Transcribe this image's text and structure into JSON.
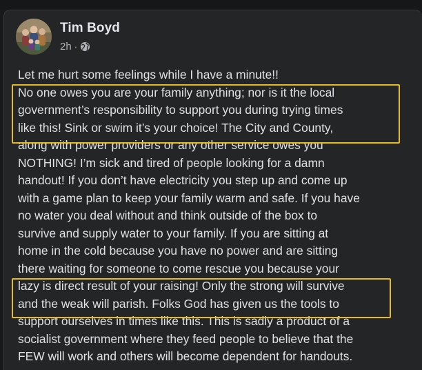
{
  "post": {
    "author": "Tim Boyd",
    "timestamp": "2h",
    "separator": "·",
    "privacy_icon": "globe-icon",
    "lines": [
      "Let me hurt some feelings while I have a minute!!",
      "No one owes you are your family anything; nor is it the local",
      "government’s responsibility to support you during trying times",
      "like this! Sink or swim it’s your choice!  The City and County,",
      "along with power providers or any other service owes you",
      "NOTHING!  I’m sick and tired of people looking for a damn",
      "handout!  If you don’t have electricity you step up and come up",
      "with a game plan to keep your family warm and safe. If you have",
      "no water you deal without and think outside of the box to",
      "survive and supply water to your family. If you are sitting at",
      "home in the cold because you have no power and are sitting",
      "there waiting for someone to come rescue you because your",
      "lazy is direct result of your raising!  Only the strong will survive",
      "and the weak will parish. Folks God has given us the tools to",
      "support ourselves in times like this. This is sadly a product of a",
      "socialist government where they feed people to believe that the",
      "FEW will work and others will become dependent for handouts."
    ]
  },
  "colors": {
    "background": "#18191a",
    "card": "#242526",
    "text": "#dfe1e5",
    "secondary_text": "#b0b3b8",
    "highlight_box": "#e6bb23"
  }
}
